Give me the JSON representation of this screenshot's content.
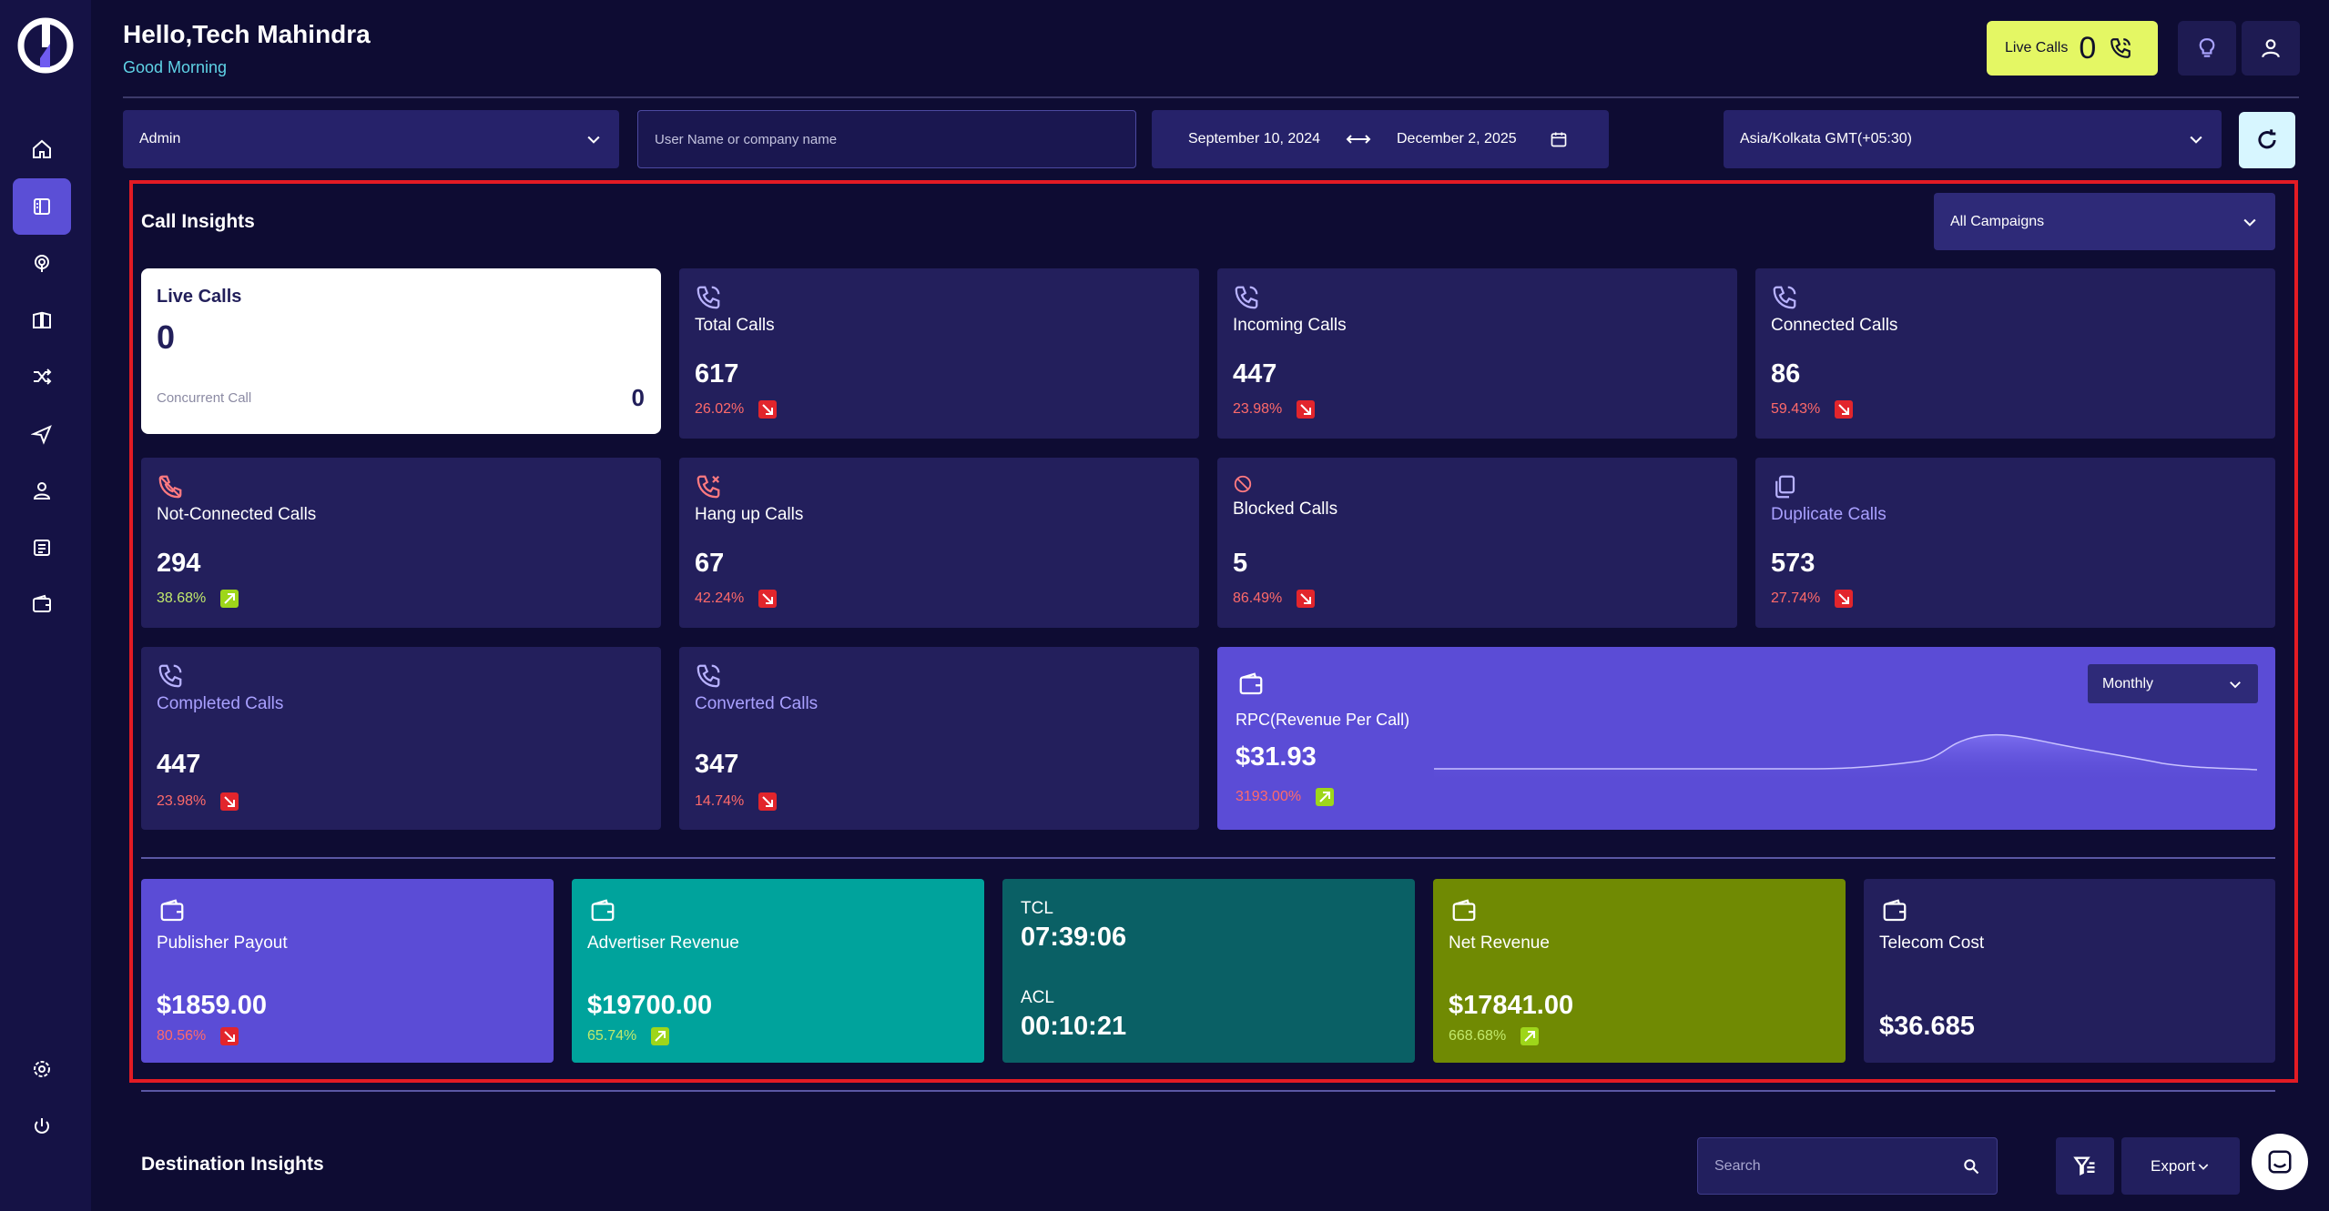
{
  "header": {
    "hello": "Hello,Tech Mahindra",
    "greeting": "Good Morning",
    "live_calls_label": "Live Calls",
    "live_calls_value": "0"
  },
  "filters": {
    "role": "Admin",
    "search_placeholder": "User Name or company name",
    "date_from": "September 10, 2024",
    "date_to": "December 2, 2025",
    "timezone": "Asia/Kolkata GMT(+05:30)"
  },
  "call_insights": {
    "title": "Call Insights",
    "campaign_select": "All Campaigns",
    "live_card": {
      "title": "Live Calls",
      "value": "0",
      "concurrent_label": "Concurrent Call",
      "concurrent_value": "0"
    },
    "cards": [
      {
        "label": "Total Calls",
        "value": "617",
        "pct": "26.02%",
        "trend": "down",
        "icon": "phone-icon"
      },
      {
        "label": "Incoming Calls",
        "value": "447",
        "pct": "23.98%",
        "trend": "down",
        "icon": "phone-incoming-icon"
      },
      {
        "label": "Connected Calls",
        "value": "86",
        "pct": "59.43%",
        "trend": "down",
        "icon": "phone-connected-icon"
      },
      {
        "label": "Not-Connected Calls",
        "value": "294",
        "pct": "38.68%",
        "trend": "up",
        "icon": "phone-off-icon"
      },
      {
        "label": "Hang up Calls",
        "value": "67",
        "pct": "42.24%",
        "trend": "down",
        "icon": "phone-x-icon"
      },
      {
        "label": "Blocked Calls",
        "value": "5",
        "pct": "86.49%",
        "trend": "down",
        "icon": "blocked-icon"
      },
      {
        "label": "Duplicate Calls",
        "value": "573",
        "pct": "27.74%",
        "trend": "down",
        "icon": "copy-icon"
      },
      {
        "label": "Completed Calls",
        "value": "447",
        "pct": "23.98%",
        "trend": "down",
        "icon": "phone-icon"
      },
      {
        "label": "Converted Calls",
        "value": "347",
        "pct": "14.74%",
        "trend": "down",
        "icon": "phone-icon"
      }
    ],
    "rpc": {
      "label": "RPC(Revenue Per Call)",
      "value": "$31.93",
      "pct": "3193.00%",
      "trend": "up",
      "period": "Monthly"
    },
    "bottom": {
      "publisher": {
        "label": "Publisher Payout",
        "value": "$1859.00",
        "pct": "80.56%",
        "trend": "down"
      },
      "advertiser": {
        "label": "Advertiser Revenue",
        "value": "$19700.00",
        "pct": "65.74%",
        "trend": "up"
      },
      "tcl": {
        "tcl_label": "TCL",
        "tcl_value": "07:39:06",
        "acl_label": "ACL",
        "acl_value": "00:10:21"
      },
      "net": {
        "label": "Net Revenue",
        "value": "$17841.00",
        "pct": "668.68%",
        "trend": "up"
      },
      "telecom": {
        "label": "Telecom Cost",
        "value": "$36.685"
      }
    }
  },
  "destination": {
    "title": "Destination Insights",
    "search_placeholder": "Search",
    "export_label": "Export"
  },
  "colors": {
    "background": "#0e0c33",
    "card": "#231f5c",
    "accent_purple": "#5b4cd6",
    "teal": "#00a39c",
    "dark_teal": "#0a6065",
    "olive": "#708a03",
    "live_yellow": "#e4f764",
    "highlight_border": "#e21b24"
  }
}
